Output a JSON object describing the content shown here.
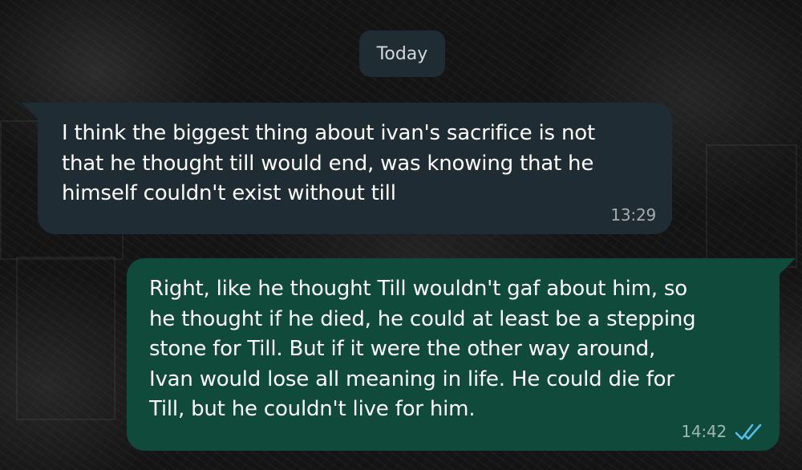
{
  "chat": {
    "date_label": "Today",
    "messages": [
      {
        "direction": "incoming",
        "text": "I think the biggest thing about ivan's sacrifice is not\nthat he thought till would end, was knowing that he\nhimself couldn't exist without till",
        "time": "13:29"
      },
      {
        "direction": "outgoing",
        "text": "Right, like he thought Till wouldn't gaf about him, so\nhe thought if he died, he could at least be a stepping\nstone for Till. But if it were the other way around,\nIvan would lose all meaning in life. He could die for\nTill, but he couldn't live for him.",
        "time": "14:42",
        "status_icon": "double-check-read-icon"
      }
    ]
  },
  "colors": {
    "incoming_bubble": "#1f2c34",
    "outgoing_bubble": "#0f4a3a",
    "read_ticks": "#53bdeb",
    "wallpaper": "#141414"
  }
}
